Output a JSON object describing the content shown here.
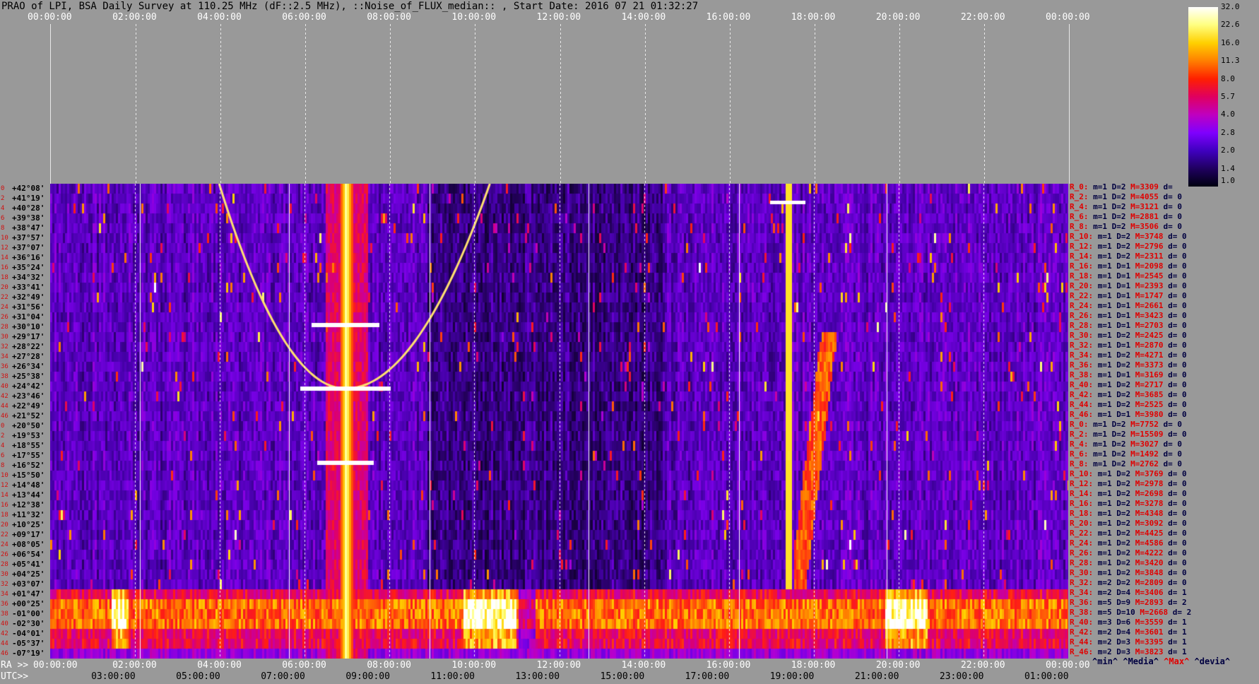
{
  "header": {
    "title": "PRAO of LPI, BSA Daily Survey at 110.25 MHz (dF::2.5 MHz), ::Noise_of_FLUX_median:: , Start Date: 2016 07 21 01:32:27"
  },
  "top_axis_labels": [
    "00:00:00",
    "02:00:00",
    "04:00:00",
    "06:00:00",
    "08:00:00",
    "10:00:00",
    "12:00:00",
    "14:00:00",
    "16:00:00",
    "18:00:00",
    "20:00:00",
    "22:00:00",
    "00:00:00"
  ],
  "ra_axis": {
    "prefix": "RA >>",
    "labels": [
      "00:00:00",
      "02:00:00",
      "04:00:00",
      "06:00:00",
      "08:00:00",
      "10:00:00",
      "12:00:00",
      "14:00:00",
      "16:00:00",
      "18:00:00",
      "20:00:00",
      "22:00:00",
      "00:00:00"
    ]
  },
  "utc_axis": {
    "prefix": "UTC>>",
    "labels": [
      "03:00:00",
      "05:00:00",
      "07:00:00",
      "09:00:00",
      "11:00:00",
      "13:00:00",
      "15:00:00",
      "17:00:00",
      "19:00:00",
      "21:00:00",
      "23:00:00",
      "01:00:00"
    ]
  },
  "colorbar": {
    "ticks": [
      "32.0",
      "22.6",
      "16.0",
      "11.3",
      "8.0",
      "5.7",
      "4.0",
      "2.8",
      "2.0",
      "1.4",
      "1.0"
    ],
    "colors": [
      "#ffffff",
      "#ffff80",
      "#ffd000",
      "#ff8000",
      "#ff2000",
      "#e00060",
      "#c000c0",
      "#8000ff",
      "#4000c0",
      "#200060",
      "#000010"
    ]
  },
  "declinations": [
    {
      "i": "0",
      "d": "+42°08'"
    },
    {
      "i": "2",
      "d": "+41°19'"
    },
    {
      "i": "4",
      "d": "+40°28'"
    },
    {
      "i": "6",
      "d": "+39°38'"
    },
    {
      "i": "8",
      "d": "+38°47'"
    },
    {
      "i": "10",
      "d": "+37°57'"
    },
    {
      "i": "12",
      "d": "+37°07'"
    },
    {
      "i": "14",
      "d": "+36°16'"
    },
    {
      "i": "16",
      "d": "+35°24'"
    },
    {
      "i": "18",
      "d": "+34°32'"
    },
    {
      "i": "20",
      "d": "+33°41'"
    },
    {
      "i": "22",
      "d": "+32°49'"
    },
    {
      "i": "24",
      "d": "+31°56'"
    },
    {
      "i": "26",
      "d": "+31°04'"
    },
    {
      "i": "28",
      "d": "+30°10'"
    },
    {
      "i": "30",
      "d": "+29°17'"
    },
    {
      "i": "32",
      "d": "+28°22'"
    },
    {
      "i": "34",
      "d": "+27°28'"
    },
    {
      "i": "36",
      "d": "+26°34'"
    },
    {
      "i": "38",
      "d": "+25°38'"
    },
    {
      "i": "40",
      "d": "+24°42'"
    },
    {
      "i": "42",
      "d": "+23°46'"
    },
    {
      "i": "44",
      "d": "+22°49'"
    },
    {
      "i": "46",
      "d": "+21°52'"
    },
    {
      "i": "0",
      "d": "+20°50'"
    },
    {
      "i": "2",
      "d": "+19°53'"
    },
    {
      "i": "4",
      "d": "+18°55'"
    },
    {
      "i": "6",
      "d": "+17°55'"
    },
    {
      "i": "8",
      "d": "+16°52'"
    },
    {
      "i": "10",
      "d": "+15°50'"
    },
    {
      "i": "12",
      "d": "+14°48'"
    },
    {
      "i": "14",
      "d": "+13°44'"
    },
    {
      "i": "16",
      "d": "+12°38'"
    },
    {
      "i": "18",
      "d": "+11°32'"
    },
    {
      "i": "20",
      "d": "+10°25'"
    },
    {
      "i": "22",
      "d": "+09°17'"
    },
    {
      "i": "24",
      "d": "+08°05'"
    },
    {
      "i": "26",
      "d": "+06°54'"
    },
    {
      "i": "28",
      "d": "+05°41'"
    },
    {
      "i": "30",
      "d": "+04°25'"
    },
    {
      "i": "32",
      "d": "+03°07'"
    },
    {
      "i": "34",
      "d": "+01°47'"
    },
    {
      "i": "36",
      "d": "+00°25'"
    },
    {
      "i": "38",
      "d": "-01°00'"
    },
    {
      "i": "40",
      "d": "-02°30'"
    },
    {
      "i": "42",
      "d": "-04°01'"
    },
    {
      "i": "44",
      "d": "-05°37'"
    },
    {
      "i": "46",
      "d": "-07°19'"
    }
  ],
  "stats": [
    {
      "r": "R_0:",
      "k": "m=1 D=2",
      "m": "M=3309",
      "d": "d="
    },
    {
      "r": "R_2:",
      "k": "m=1 D=2",
      "m": "M=4055",
      "d": "d= 0"
    },
    {
      "r": "R_4:",
      "k": "m=1 D=2",
      "m": "M=3121",
      "d": "d= 0"
    },
    {
      "r": "R_6:",
      "k": "m=1 D=2",
      "m": "M=2881",
      "d": "d= 0"
    },
    {
      "r": "R_8:",
      "k": "m=1 D=2",
      "m": "M=3506",
      "d": "d= 0"
    },
    {
      "r": "R_10:",
      "k": "m=1 D=2",
      "m": "M=3748",
      "d": "d= 0"
    },
    {
      "r": "R_12:",
      "k": "m=1 D=2",
      "m": "M=2796",
      "d": "d= 0"
    },
    {
      "r": "R_14:",
      "k": "m=1 D=2",
      "m": "M=2311",
      "d": "d= 0"
    },
    {
      "r": "R_16:",
      "k": "m=1 D=1",
      "m": "M=2098",
      "d": "d= 0"
    },
    {
      "r": "R_18:",
      "k": "m=1 D=1",
      "m": "M=2545",
      "d": "d= 0"
    },
    {
      "r": "R_20:",
      "k": "m=1 D=1",
      "m": "M=2393",
      "d": "d= 0"
    },
    {
      "r": "R_22:",
      "k": "m=1 D=1",
      "m": "M=1747",
      "d": "d= 0"
    },
    {
      "r": "R_24:",
      "k": "m=1 D=1",
      "m": "M=2661",
      "d": "d= 0"
    },
    {
      "r": "R_26:",
      "k": "m=1 D=1",
      "m": "M=3423",
      "d": "d= 0"
    },
    {
      "r": "R_28:",
      "k": "m=1 D=1",
      "m": "M=2703",
      "d": "d= 0"
    },
    {
      "r": "R_30:",
      "k": "m=1 D=2",
      "m": "M=2425",
      "d": "d= 0"
    },
    {
      "r": "R_32:",
      "k": "m=1 D=1",
      "m": "M=2870",
      "d": "d= 0"
    },
    {
      "r": "R_34:",
      "k": "m=1 D=2",
      "m": "M=4271",
      "d": "d= 0"
    },
    {
      "r": "R_36:",
      "k": "m=1 D=2",
      "m": "M=3373",
      "d": "d= 0"
    },
    {
      "r": "R_38:",
      "k": "m=1 D=1",
      "m": "M=3169",
      "d": "d= 0"
    },
    {
      "r": "R_40:",
      "k": "m=1 D=2",
      "m": "M=2717",
      "d": "d= 0"
    },
    {
      "r": "R_42:",
      "k": "m=1 D=2",
      "m": "M=3685",
      "d": "d= 0"
    },
    {
      "r": "R_44:",
      "k": "m=1 D=2",
      "m": "M=2525",
      "d": "d= 0"
    },
    {
      "r": "R_46:",
      "k": "m=1 D=1",
      "m": "M=3980",
      "d": "d= 0"
    },
    {
      "r": "R_0:",
      "k": "m=1 D=2",
      "m": "M=7752",
      "d": "d= 0"
    },
    {
      "r": "R_2:",
      "k": "m=1 D=2",
      "m": "M=15509",
      "d": "d= 0"
    },
    {
      "r": "R_4:",
      "k": "m=1 D=2",
      "m": "M=3027",
      "d": "d= 0"
    },
    {
      "r": "R_6:",
      "k": "m=1 D=2",
      "m": "M=1492",
      "d": "d= 0"
    },
    {
      "r": "R_8:",
      "k": "m=1 D=2",
      "m": "M=2762",
      "d": "d= 0"
    },
    {
      "r": "R_10:",
      "k": "m=1 D=2",
      "m": "M=3769",
      "d": "d= 0"
    },
    {
      "r": "R_12:",
      "k": "m=1 D=2",
      "m": "M=2978",
      "d": "d= 0"
    },
    {
      "r": "R_14:",
      "k": "m=1 D=2",
      "m": "M=2698",
      "d": "d= 0"
    },
    {
      "r": "R_16:",
      "k": "m=1 D=2",
      "m": "M=3278",
      "d": "d= 0"
    },
    {
      "r": "R_18:",
      "k": "m=1 D=2",
      "m": "M=4348",
      "d": "d= 0"
    },
    {
      "r": "R_20:",
      "k": "m=1 D=2",
      "m": "M=3092",
      "d": "d= 0"
    },
    {
      "r": "R_22:",
      "k": "m=1 D=2",
      "m": "M=4425",
      "d": "d= 0"
    },
    {
      "r": "R_24:",
      "k": "m=1 D=2",
      "m": "M=4586",
      "d": "d= 0"
    },
    {
      "r": "R_26:",
      "k": "m=1 D=2",
      "m": "M=4222",
      "d": "d= 0"
    },
    {
      "r": "R_28:",
      "k": "m=1 D=2",
      "m": "M=3420",
      "d": "d= 0"
    },
    {
      "r": "R_30:",
      "k": "m=1 D=2",
      "m": "M=3848",
      "d": "d= 0"
    },
    {
      "r": "R_32:",
      "k": "m=2 D=2",
      "m": "M=2809",
      "d": "d= 0"
    },
    {
      "r": "R_34:",
      "k": "m=2 D=4",
      "m": "M=3406",
      "d": "d= 1"
    },
    {
      "r": "R_36:",
      "k": "m=5 D=9",
      "m": "M=2893",
      "d": "d= 2"
    },
    {
      "r": "R_38:",
      "k": "m=5 D=10",
      "m": "M=2668",
      "d": "d= 2"
    },
    {
      "r": "R_40:",
      "k": "m=3 D=6",
      "m": "M=3559",
      "d": "d= 1"
    },
    {
      "r": "R_42:",
      "k": "m=2 D=4",
      "m": "M=3601",
      "d": "d= 1"
    },
    {
      "r": "R_44:",
      "k": "m=2 D=3",
      "m": "M=3395",
      "d": "d= 1"
    },
    {
      "r": "R_46:",
      "k": "m=2 D=3",
      "m": "M=3823",
      "d": "d= 1"
    }
  ],
  "legend": {
    "min": "^min^",
    "media": "^Media^",
    "max": "^Max^",
    "devia": "^devia^"
  }
}
